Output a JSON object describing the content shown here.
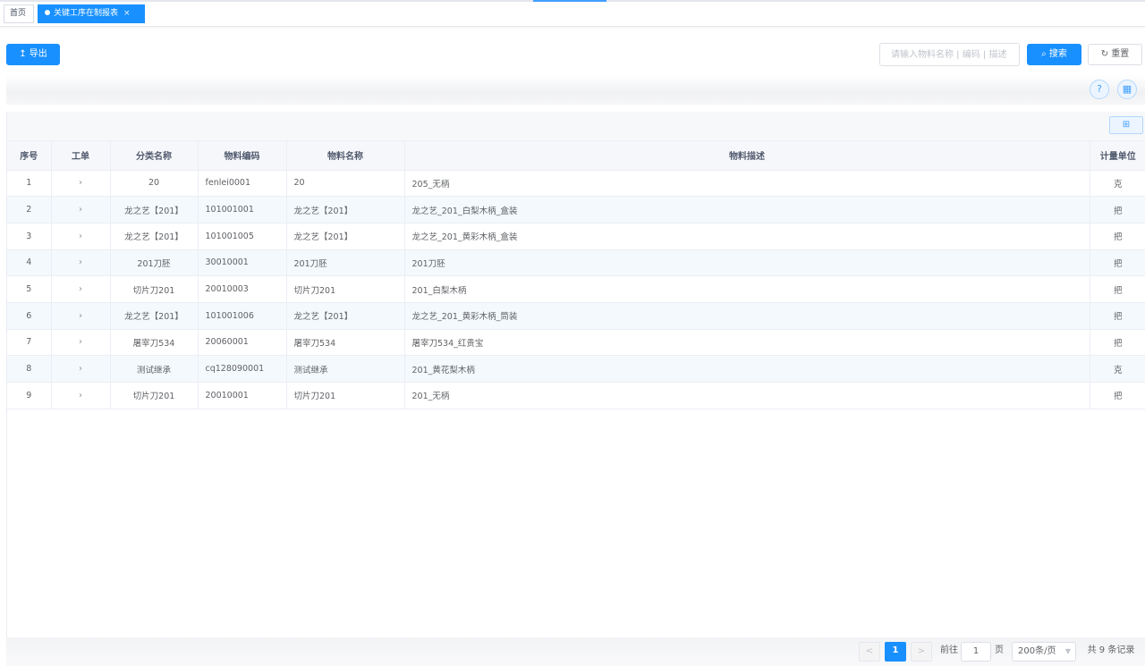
{
  "tabs": [
    {
      "label": "首页"
    },
    {
      "label": "关键工序在制报表",
      "close": "×"
    }
  ],
  "toolbar": {
    "export_label": "导出",
    "search_placeholder": "请输入物料名称 | 编码 | 描述",
    "search_label": "搜索",
    "reset_label": "重置"
  },
  "icons": {
    "export": "upload-icon",
    "search": "search-icon",
    "reset": "refresh-icon",
    "help": "question-icon",
    "grid": "grid-icon",
    "expand": "chevron-right-icon"
  },
  "colors": {
    "primary": "#1890ff",
    "header_bg": "#f5f7fa",
    "stripe": "#f4f9fd"
  },
  "table": {
    "columns": [
      "序号",
      "工单",
      "分类名称",
      "物料编码",
      "物料名称",
      "物料描述",
      "计量单位"
    ],
    "rows": [
      {
        "no": "1",
        "category": "20",
        "code": "fenlei0001",
        "name": "20",
        "desc": "205_无柄",
        "unit": "克"
      },
      {
        "no": "2",
        "category": "龙之艺【201】",
        "code": "101001001",
        "name": "龙之艺【201】",
        "desc": "龙之艺_201_白梨木柄_盒装",
        "unit": "把"
      },
      {
        "no": "3",
        "category": "龙之艺【201】",
        "code": "101001005",
        "name": "龙之艺【201】",
        "desc": "龙之艺_201_黄彩木柄_盒装",
        "unit": "把"
      },
      {
        "no": "4",
        "category": "201刀胚",
        "code": "30010001",
        "name": "201刀胚",
        "desc": "201刀胚",
        "unit": "把"
      },
      {
        "no": "5",
        "category": "切片刀201",
        "code": "20010003",
        "name": "切片刀201",
        "desc": "201_白梨木柄",
        "unit": "把"
      },
      {
        "no": "6",
        "category": "龙之艺【201】",
        "code": "101001006",
        "name": "龙之艺【201】",
        "desc": "龙之艺_201_黄彩木柄_筒装",
        "unit": "把"
      },
      {
        "no": "7",
        "category": "屠宰刀534",
        "code": "20060001",
        "name": "屠宰刀534",
        "desc": "屠宰刀534_红贵宝",
        "unit": "把"
      },
      {
        "no": "8",
        "category": "测试继承",
        "code": "cq128090001",
        "name": "测试继承",
        "desc": "201_黄花梨木柄",
        "unit": "克"
      },
      {
        "no": "9",
        "category": "切片刀201",
        "code": "20010001",
        "name": "切片刀201",
        "desc": "201_无柄",
        "unit": "把"
      }
    ]
  },
  "pagination": {
    "prev": "<",
    "current": "1",
    "next": ">",
    "goto_prefix": "前往",
    "goto_value": "1",
    "goto_suffix": "页",
    "page_size": "200条/页",
    "total": "共 9 条记录"
  }
}
